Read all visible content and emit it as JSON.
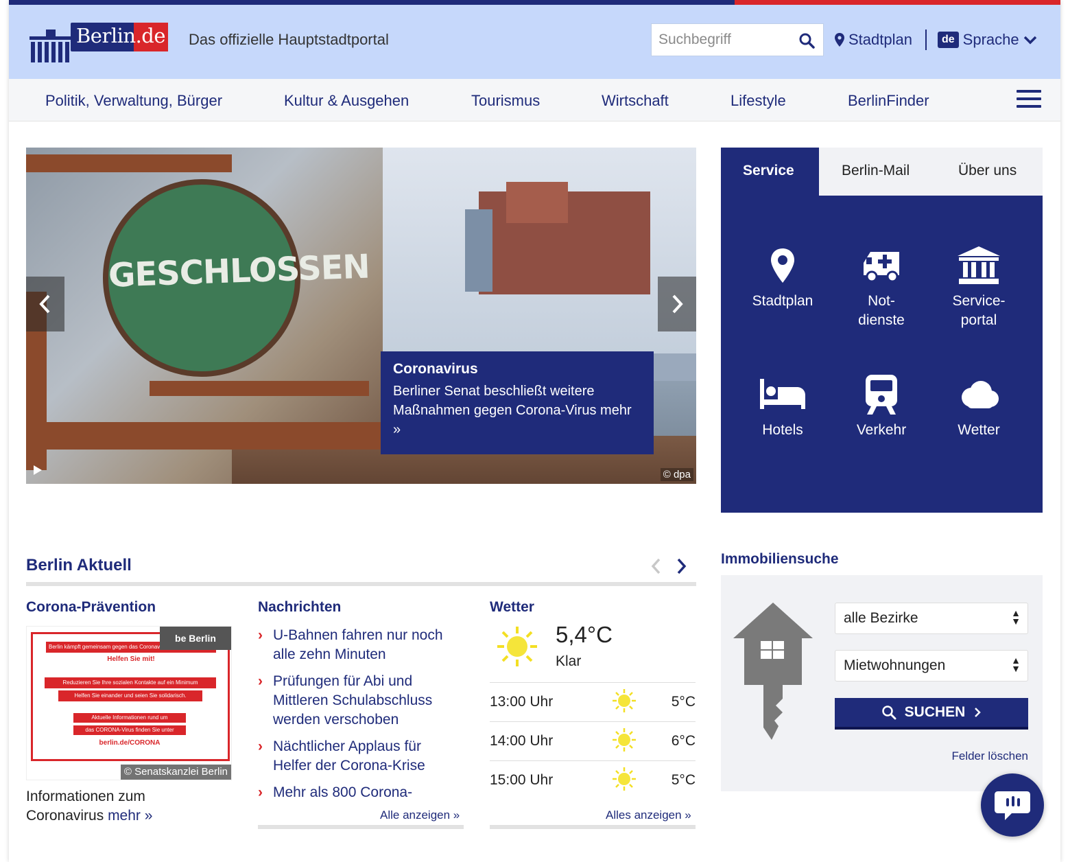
{
  "header": {
    "logo_text": "Berlin.de",
    "tagline": "Das offizielle Hauptstadtportal",
    "search_placeholder": "Suchbegriff",
    "stadtplan_label": "Stadtplan",
    "lang_badge": "de",
    "lang_label": "Sprache"
  },
  "nav": {
    "items": [
      "Politik, Verwaltung, Bürger",
      "Kultur & Ausgehen",
      "Tourismus",
      "Wirtschaft",
      "Lifestyle",
      "BerlinFinder"
    ]
  },
  "hero": {
    "sign_text": "GESCHLOSSEN",
    "caption_title": "Coronavirus",
    "caption_text": "Berliner Senat beschließt weitere Maßnahmen gegen Corona-Virus",
    "caption_more": "mehr »",
    "credit": "© dpa"
  },
  "service": {
    "tabs": [
      "Service",
      "Berlin-Mail",
      "Über uns"
    ],
    "tiles": [
      {
        "label_1": "Stadtplan",
        "label_2": "",
        "icon": "map-pin-icon"
      },
      {
        "label_1": "Not-",
        "label_2": "dienste",
        "icon": "ambulance-icon"
      },
      {
        "label_1": "Service-",
        "label_2": "portal",
        "icon": "building-icon"
      },
      {
        "label_1": "Hotels",
        "label_2": "",
        "icon": "bed-icon"
      },
      {
        "label_1": "Verkehr",
        "label_2": "",
        "icon": "train-icon"
      },
      {
        "label_1": "Wetter",
        "label_2": "",
        "icon": "cloud-icon"
      }
    ]
  },
  "aktuell": {
    "title": "Berlin Aktuell",
    "corona": {
      "title": "Corona-Prävention",
      "poster_lines": [
        "Berlin kämpft gemeinsam gegen das Coronavirus",
        "Helfen Sie mit!",
        "Reduzieren Sie Ihre sozialen Kontakte auf ein Minimum",
        "Helfen Sie einander und seien Sie solidarisch.",
        "Aktuelle Informationen rund um",
        "das CORONA-Virus finden Sie unter",
        "berlin.de/CORONA"
      ],
      "poster_brand": "be Berlin",
      "credit": "© Senatskanzlei Berlin",
      "text_1": "Informationen zum",
      "text_2": "Coronavirus",
      "more": "mehr »"
    },
    "news": {
      "title": "Nachrichten",
      "items": [
        {
          "line1": "U-Bahnen fahren nur noch",
          "line2": "alle zehn Minuten",
          "line3": ""
        },
        {
          "line1": "Prüfungen für Abi und",
          "line2": "Mittleren Schulabschluss",
          "line3": "werden verschoben"
        },
        {
          "line1": "Nächtlicher Applaus für",
          "line2": "Helfer der Corona-Krise",
          "line3": ""
        },
        {
          "line1": "Mehr als 800 Corona-",
          "line2": "",
          "line3": ""
        }
      ],
      "more": "Alle anzeigen »"
    },
    "weather": {
      "title": "Wetter",
      "temp": "5,4°C",
      "condition": "Klar",
      "rows": [
        {
          "time": "13:00 Uhr",
          "temp": "5°C"
        },
        {
          "time": "14:00 Uhr",
          "temp": "6°C"
        },
        {
          "time": "15:00 Uhr",
          "temp": "5°C"
        }
      ],
      "more": "Alles anzeigen »"
    }
  },
  "immo": {
    "title": "Immobiliensuche",
    "district": "alle Bezirke",
    "type": "Mietwohnungen",
    "search_label": "SUCHEN",
    "clear_label": "Felder löschen"
  },
  "colors": {
    "brand_blue": "#1f2b7a",
    "brand_red": "#d9262a",
    "header_bg": "#c6d8fb"
  }
}
